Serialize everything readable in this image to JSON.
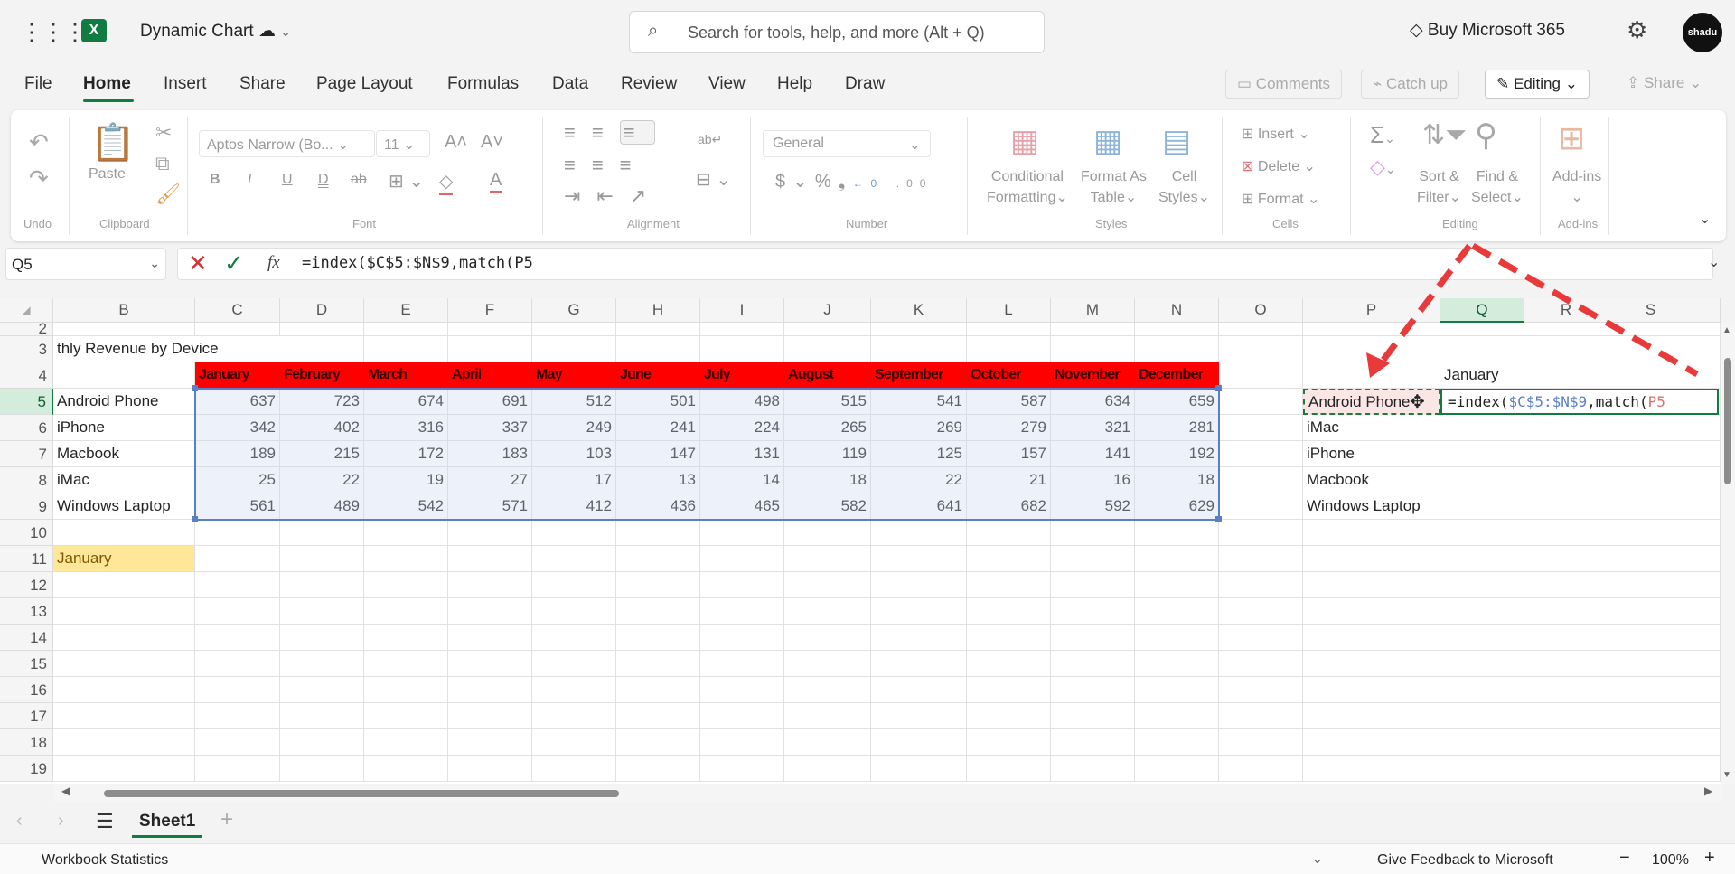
{
  "app": {
    "title": "Dynamic Chart",
    "search_placeholder": "Search for tools, help, and more (Alt + Q)",
    "buy_label": "Buy Microsoft 365",
    "avatar_text": "shadu"
  },
  "menu": {
    "tabs": [
      "File",
      "Home",
      "Insert",
      "Share",
      "Page Layout",
      "Formulas",
      "Data",
      "Review",
      "View",
      "Help",
      "Draw"
    ],
    "active": "Home"
  },
  "actions": {
    "comments": "Comments",
    "catch_up": "Catch up",
    "editing": "Editing",
    "share": "Share"
  },
  "ribbon": {
    "groups": [
      "Undo",
      "Clipboard",
      "Font",
      "Alignment",
      "Number",
      "Styles",
      "Cells",
      "Editing",
      "Add-ins"
    ],
    "paste": "Paste",
    "font_name": "Aptos Narrow (Bo...",
    "font_size": "11",
    "number_format": "General",
    "conditional_formatting": [
      "Conditional",
      "Formatting"
    ],
    "format_as_table": [
      "Format As",
      "Table"
    ],
    "cell_styles": [
      "Cell",
      "Styles"
    ],
    "insert": "Insert",
    "delete": "Delete",
    "format": "Format",
    "sort_filter": [
      "Sort &",
      "Filter"
    ],
    "find_select": [
      "Find &",
      "Select"
    ],
    "add_ins": "Add-ins"
  },
  "formula_bar": {
    "name_box": "Q5",
    "formula": "=index($C$5:$N$9,match(P5"
  },
  "sheet": {
    "columns": [
      "B",
      "C",
      "D",
      "E",
      "F",
      "G",
      "H",
      "I",
      "J",
      "K",
      "L",
      "M",
      "N",
      "O",
      "P",
      "Q",
      "R",
      "S"
    ],
    "rows": [
      "2",
      "3",
      "4",
      "5",
      "6",
      "7",
      "8",
      "9",
      "10",
      "11",
      "12",
      "13",
      "14",
      "15",
      "16",
      "17",
      "18",
      "19"
    ],
    "selected_column": "Q",
    "selected_row": "5",
    "title_cell": "thly Revenue by Device",
    "months": [
      "January",
      "February",
      "March",
      "April",
      "May",
      "June",
      "July",
      "August",
      "September",
      "October",
      "November",
      "December"
    ],
    "table": [
      {
        "device": "Android Phone",
        "values": [
          637,
          723,
          674,
          691,
          512,
          501,
          498,
          515,
          541,
          587,
          634,
          659
        ]
      },
      {
        "device": "iPhone",
        "values": [
          342,
          402,
          316,
          337,
          249,
          241,
          224,
          265,
          269,
          279,
          321,
          281
        ]
      },
      {
        "device": "Macbook",
        "values": [
          189,
          215,
          172,
          183,
          103,
          147,
          131,
          119,
          125,
          157,
          141,
          192
        ]
      },
      {
        "device": "iMac",
        "values": [
          25,
          22,
          19,
          27,
          17,
          13,
          14,
          18,
          22,
          21,
          16,
          18
        ]
      },
      {
        "device": "Windows Laptop",
        "values": [
          561,
          489,
          542,
          571,
          412,
          436,
          465,
          582,
          641,
          682,
          592,
          629
        ]
      }
    ],
    "b11": "January",
    "lookup": {
      "month_header": "January",
      "devices": [
        "Android Phone",
        "iMac",
        "iPhone",
        "Macbook",
        "Windows Laptop"
      ],
      "formula_parts": {
        "prefix": "=index(",
        "range": "$C$5:$N$9",
        "middle": ",match(",
        "ref": "P5"
      }
    }
  },
  "sheet_tabs": {
    "active": "Sheet1",
    "add": "+"
  },
  "status": {
    "left": "Workbook Statistics",
    "feedback": "Give Feedback to Microsoft",
    "zoom": "100%"
  },
  "colors": {
    "excel_green": "#107c41",
    "header_red": "#ff0000",
    "highlight_yellow": "#ffe699",
    "selection_blue": "#5b7fc7",
    "arrow_red": "#e83a3a"
  }
}
